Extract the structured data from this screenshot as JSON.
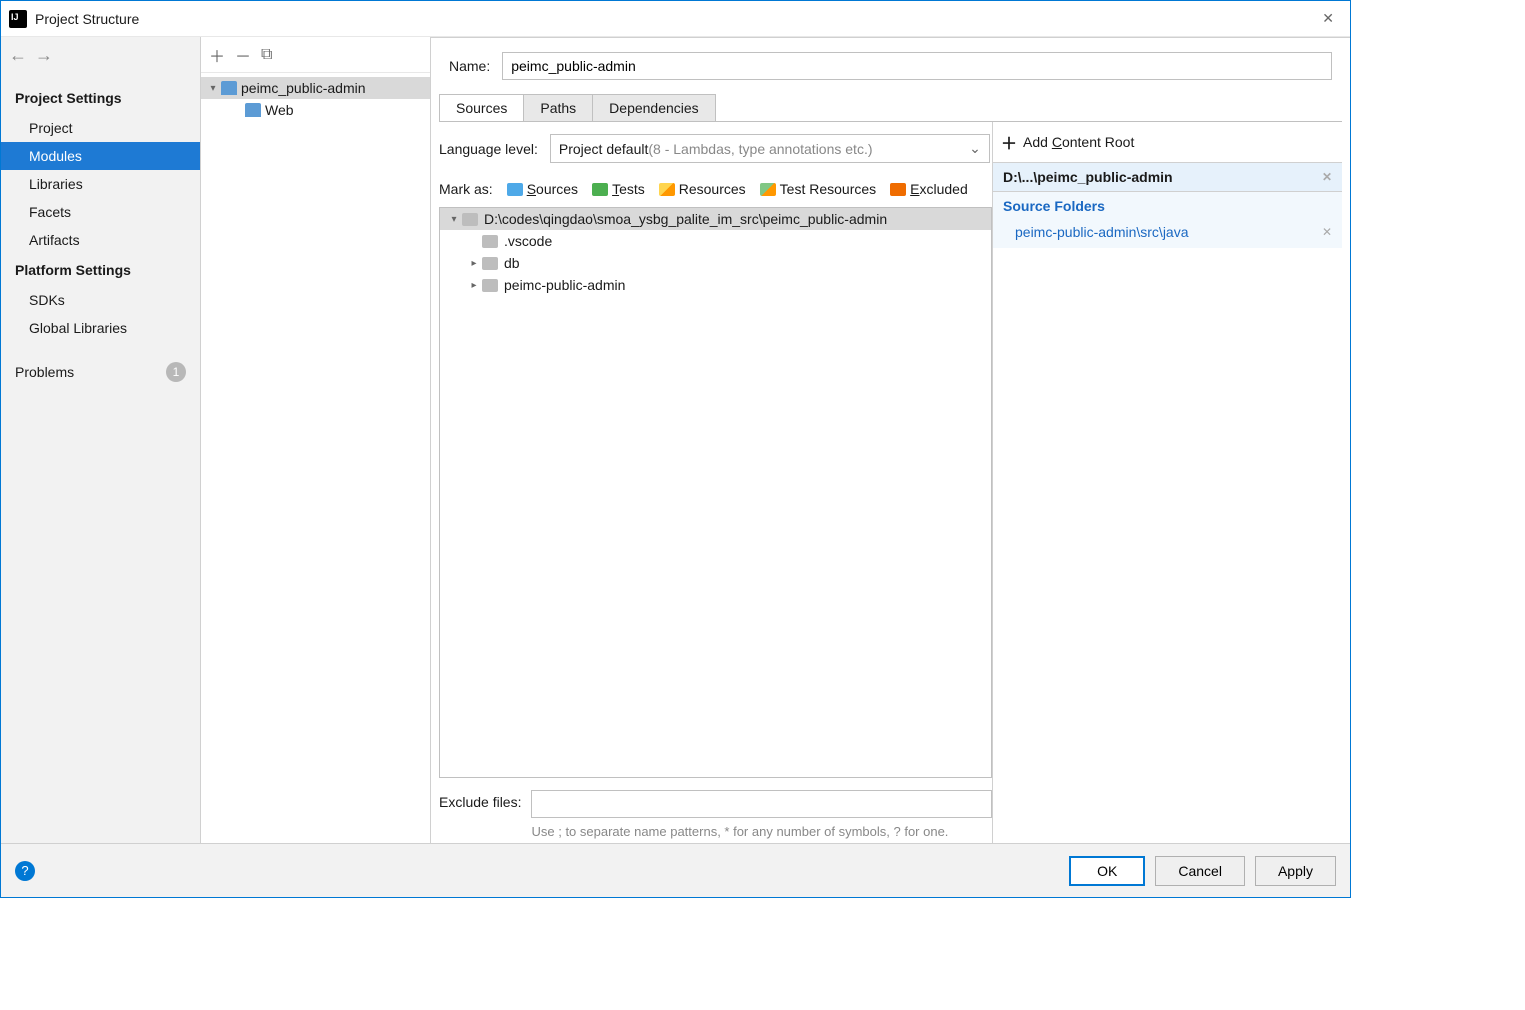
{
  "window": {
    "title": "Project Structure"
  },
  "sidebar": {
    "sections": [
      {
        "title": "Project Settings",
        "items": [
          "Project",
          "Modules",
          "Libraries",
          "Facets",
          "Artifacts"
        ],
        "selectedIndex": 1
      },
      {
        "title": "Platform Settings",
        "items": [
          "SDKs",
          "Global Libraries"
        ]
      }
    ],
    "problems": {
      "label": "Problems",
      "count": "1"
    }
  },
  "moduleTree": {
    "root": "peimc_public-admin",
    "children": [
      "Web"
    ]
  },
  "detail": {
    "nameLabel": "Name:",
    "nameValue": "peimc_public-admin",
    "tabs": [
      "Sources",
      "Paths",
      "Dependencies"
    ],
    "activeTab": 0,
    "languageLevel": {
      "label": "Language level:",
      "value": "Project default ",
      "hint": "(8 - Lambdas, type annotations etc.)"
    },
    "markAs": {
      "label": "Mark as:",
      "items": [
        "Sources",
        "Tests",
        "Resources",
        "Test Resources",
        "Excluded"
      ]
    },
    "folderTree": {
      "root": "D:\\codes\\qingdao\\smoa_ysbg_palite_im_src\\peimc_public-admin",
      "children": [
        ".vscode",
        "db",
        "peimc-public-admin"
      ]
    },
    "excludeFiles": {
      "label": "Exclude files:",
      "value": "",
      "hint": "Use ; to separate name patterns, * for any number of symbols, ? for one."
    },
    "contentRoots": {
      "addLabel": "Add Content Root",
      "root": "D:\\...\\peimc_public-admin",
      "sourceFoldersLabel": "Source Folders",
      "folders": [
        "peimc-public-admin\\src\\java"
      ]
    }
  },
  "footer": {
    "ok": "OK",
    "cancel": "Cancel",
    "apply": "Apply"
  }
}
